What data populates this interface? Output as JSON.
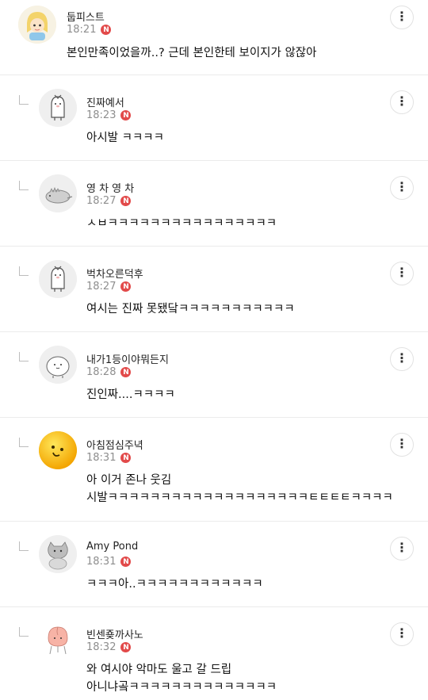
{
  "comments": [
    {
      "nick": "둡피스트",
      "time": "18:21",
      "badge": "N",
      "text": "본인만족이었을까..? 근데 본인한테 보이지가 않잖아",
      "avatar": "blonde-girl-avatar-icon"
    },
    {
      "nick": "진짜예서",
      "time": "18:23",
      "badge": "N",
      "text": "아시발 ㅋㅋㅋㅋ",
      "avatar": "white-bird-avatar-icon"
    },
    {
      "nick": "영 차 영 차",
      "time": "18:27",
      "badge": "N",
      "text": "ㅅㅂㅋㅋㅋㅋㅋㅋㅋㅋㅋㅋㅋㅋㅋㅋㅋㅋ",
      "avatar": "gray-dinosaur-avatar-icon"
    },
    {
      "nick": "벅차오른덕후",
      "time": "18:27",
      "badge": "N",
      "text": "여시는 진짜 못됐닼ㅋㅋㅋㅋㅋㅋㅋㅋㅋㅋㅋ",
      "avatar": "white-bird-avatar-icon"
    },
    {
      "nick": "내가1등이야뭐든지",
      "time": "18:28",
      "badge": "N",
      "text": "진인짜....ㅋㅋㅋㅋ",
      "avatar": "white-blob-avatar-icon"
    },
    {
      "nick": "아침점심주녁",
      "time": "18:31",
      "badge": "N",
      "text": "아 이거 존나 웃김\n시발ㅋㅋㅋㅋㅋㅋㅋㅋㅋㅋㅋㅋㅋㅋㅋㅋㅋㅋㅋㅌㅌㅌㅌㅋㅋㅋㅋ",
      "avatar": "yellow-smiley-avatar-icon"
    },
    {
      "nick": "Amy Pond",
      "time": "18:31",
      "badge": "N",
      "text": "ㅋㅋㅋ아..ㅋㅋㅋㅋㅋㅋㅋㅋㅋㅋㅋㅋ",
      "avatar": "gray-cat-avatar-icon"
    },
    {
      "nick": "빈센죶까사노",
      "time": "18:32",
      "badge": "N",
      "text": "와 여시야 악마도 울고 갈 드립\n아니냐곸ㅋㅋㅋㅋㅋㅋㅋㅋㅋㅋㅋㅋㅋㅋ",
      "avatar": "peach-character-avatar-icon"
    }
  ],
  "more_icon": "⋮",
  "colors": {
    "badge": "#e24a4a",
    "divider": "#ebebeb",
    "time": "#8e8e8e"
  }
}
